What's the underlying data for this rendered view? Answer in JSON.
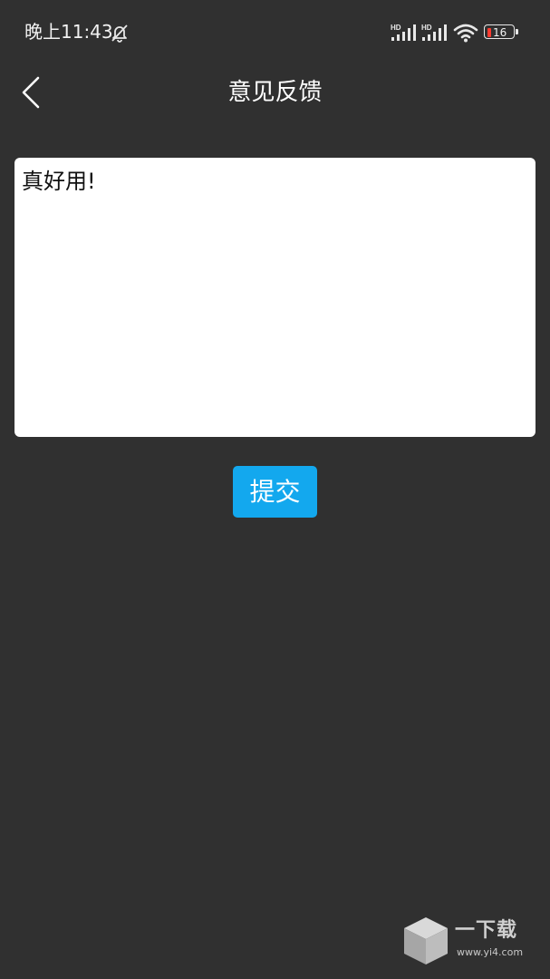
{
  "status_bar": {
    "time": "晚上11:43",
    "signal_label_1": "HD",
    "signal_label_2": "HD",
    "battery_level": "16",
    "battery_level_fraction": 0.16,
    "icons": [
      "bell-off-icon",
      "signal-icon",
      "signal-icon",
      "wifi-icon",
      "battery-icon"
    ]
  },
  "header": {
    "title": "意见反馈",
    "back_icon": "chevron-left-icon"
  },
  "feedback": {
    "value": "真好用!"
  },
  "submit": {
    "label": "提交"
  },
  "watermark": {
    "brand": "一下载",
    "url": "www.yi4.com"
  },
  "colors": {
    "background": "#303030",
    "accent": "#13a8ee",
    "battery_low": "#ff3b30",
    "input_bg": "#ffffff"
  }
}
